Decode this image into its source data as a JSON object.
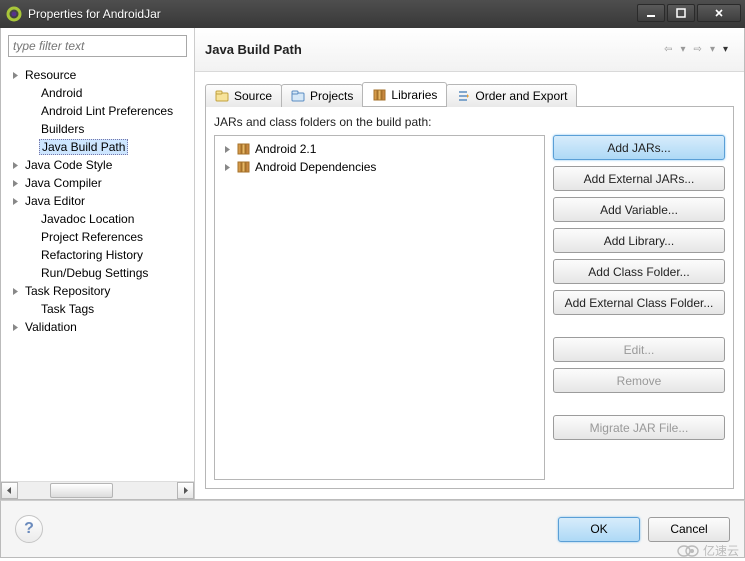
{
  "window": {
    "title": "Properties for AndroidJar"
  },
  "sidebar": {
    "filter_placeholder": "type filter text",
    "items": [
      {
        "label": "Resource",
        "expandable": true,
        "indent": 0
      },
      {
        "label": "Android",
        "expandable": false,
        "indent": 1
      },
      {
        "label": "Android Lint Preferences",
        "expandable": false,
        "indent": 1
      },
      {
        "label": "Builders",
        "expandable": false,
        "indent": 1
      },
      {
        "label": "Java Build Path",
        "expandable": false,
        "indent": 1,
        "selected": true
      },
      {
        "label": "Java Code Style",
        "expandable": true,
        "indent": 0
      },
      {
        "label": "Java Compiler",
        "expandable": true,
        "indent": 0
      },
      {
        "label": "Java Editor",
        "expandable": true,
        "indent": 0
      },
      {
        "label": "Javadoc Location",
        "expandable": false,
        "indent": 1
      },
      {
        "label": "Project References",
        "expandable": false,
        "indent": 1
      },
      {
        "label": "Refactoring History",
        "expandable": false,
        "indent": 1
      },
      {
        "label": "Run/Debug Settings",
        "expandable": false,
        "indent": 1
      },
      {
        "label": "Task Repository",
        "expandable": true,
        "indent": 0
      },
      {
        "label": "Task Tags",
        "expandable": false,
        "indent": 1
      },
      {
        "label": "Validation",
        "expandable": true,
        "indent": 0
      }
    ]
  },
  "main": {
    "heading": "Java Build Path",
    "tabs": [
      {
        "label": "Source",
        "active": false
      },
      {
        "label": "Projects",
        "active": false
      },
      {
        "label": "Libraries",
        "active": true
      },
      {
        "label": "Order and Export",
        "active": false
      }
    ],
    "jars_caption": "JARs and class folders on the build path:",
    "jar_entries": [
      {
        "label": "Android 2.1"
      },
      {
        "label": "Android Dependencies"
      }
    ],
    "buttons": [
      {
        "label": "Add JARs...",
        "enabled": true,
        "highlight": true
      },
      {
        "label": "Add External JARs...",
        "enabled": true
      },
      {
        "label": "Add Variable...",
        "enabled": true
      },
      {
        "label": "Add Library...",
        "enabled": true
      },
      {
        "label": "Add Class Folder...",
        "enabled": true
      },
      {
        "label": "Add External Class Folder...",
        "enabled": true
      },
      {
        "gap": true
      },
      {
        "label": "Edit...",
        "enabled": false
      },
      {
        "label": "Remove",
        "enabled": false
      },
      {
        "gap": true
      },
      {
        "label": "Migrate JAR File...",
        "enabled": false
      }
    ]
  },
  "footer": {
    "ok": "OK",
    "cancel": "Cancel"
  },
  "watermark": "亿速云"
}
